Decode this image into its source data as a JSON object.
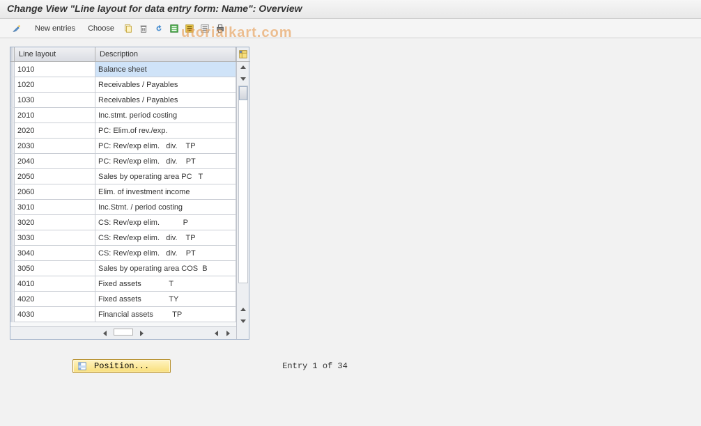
{
  "header": {
    "title": "Change View \"Line layout for data entry form: Name\": Overview"
  },
  "toolbar": {
    "new_entries": "New entries",
    "choose": "Choose"
  },
  "watermark": "utorialkart.com",
  "table": {
    "col1": "Line layout",
    "col2": "Description",
    "rows": [
      {
        "code": "1010",
        "desc": "Balance sheet"
      },
      {
        "code": "1020",
        "desc": "Receivables / Payables"
      },
      {
        "code": "1030",
        "desc": "Receivables / Payables"
      },
      {
        "code": "2010",
        "desc": "Inc.stmt. period costing"
      },
      {
        "code": "2020",
        "desc": "PC: Elim.of rev./exp."
      },
      {
        "code": "2030",
        "desc": "PC: Rev/exp elim.   div.    TP"
      },
      {
        "code": "2040",
        "desc": "PC: Rev/exp elim.   div.    PT"
      },
      {
        "code": "2050",
        "desc": "Sales by operating area PC   T"
      },
      {
        "code": "2060",
        "desc": "Elim. of investment income"
      },
      {
        "code": "3010",
        "desc": "Inc.Stmt. / period costing"
      },
      {
        "code": "3020",
        "desc": "CS: Rev/exp elim.           P"
      },
      {
        "code": "3030",
        "desc": "CS: Rev/exp elim.   div.    TP"
      },
      {
        "code": "3040",
        "desc": "CS: Rev/exp elim.   div.    PT"
      },
      {
        "code": "3050",
        "desc": "Sales by operating area COS  B"
      },
      {
        "code": "4010",
        "desc": "Fixed assets             T"
      },
      {
        "code": "4020",
        "desc": "Fixed assets             TY"
      },
      {
        "code": "4030",
        "desc": "Financial assets         TP"
      }
    ]
  },
  "footer": {
    "position_label": "Position...",
    "entry_text": "Entry 1 of 34"
  }
}
